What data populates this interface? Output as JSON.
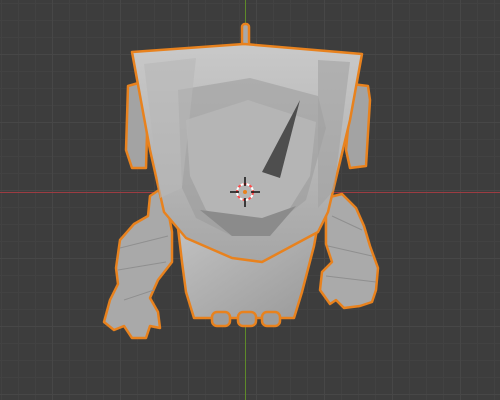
{
  "viewport": {
    "background": "#3d3d3d",
    "grid_color": "#474747",
    "x_axis_color": "#9c3c42",
    "y_axis_color": "#5e8a2a",
    "selection_outline_color": "#e8821e"
  },
  "object": {
    "type": "cartoon-robot-mesh",
    "selected": true,
    "shading": "solid-gray"
  },
  "gizmo": {
    "type": "3d-cursor"
  }
}
